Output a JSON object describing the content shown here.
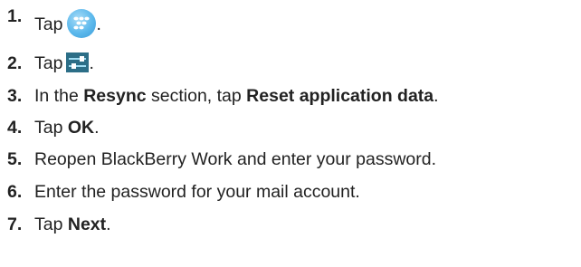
{
  "steps": [
    {
      "number": "1.",
      "prefix": "Tap",
      "icon": "blackberry-home-icon",
      "suffix": "."
    },
    {
      "number": "2.",
      "prefix": "Tap",
      "icon": "settings-sliders-icon",
      "suffix": "."
    },
    {
      "number": "3.",
      "text1": "In the ",
      "bold1": "Resync",
      "text2": " section, tap ",
      "bold2": "Reset application data",
      "text3": "."
    },
    {
      "number": "4.",
      "text1": "Tap ",
      "bold1": "OK",
      "text2": "."
    },
    {
      "number": "5.",
      "text1": "Reopen BlackBerry Work and enter your password."
    },
    {
      "number": "6.",
      "text1": "Enter the password for your mail account."
    },
    {
      "number": "7.",
      "text1": "Tap ",
      "bold1": "Next",
      "text2": "."
    }
  ],
  "colors": {
    "text": "#222222",
    "blackberry_icon_blue": "#5bb8ec",
    "settings_icon_bg": "#2c6e87",
    "settings_icon_bar": "#9fdcf3"
  }
}
